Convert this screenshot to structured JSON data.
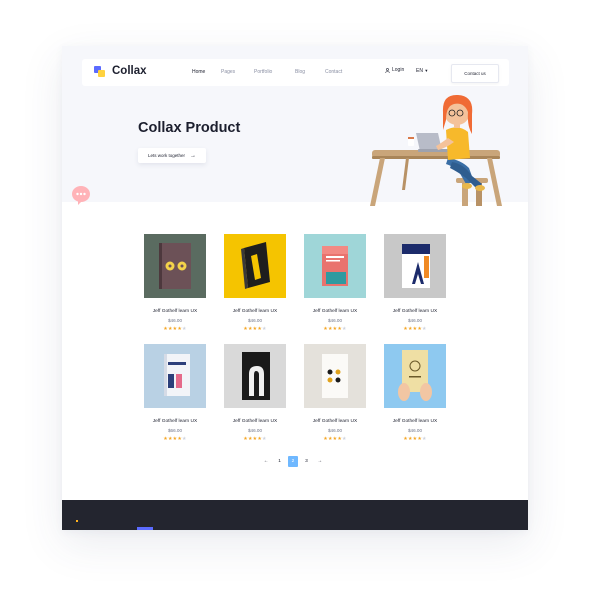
{
  "brand": {
    "name": "Collax"
  },
  "nav": {
    "links": [
      "Home",
      "Pages",
      "Portfolio",
      "Blog",
      "Contact"
    ],
    "active_index": 0,
    "login": "Login",
    "language": "EN",
    "contact_button": "Contact us"
  },
  "hero": {
    "title": "Collax Product",
    "cta": "Lets work together",
    "cta_icon": "arrow-right-icon"
  },
  "products": [
    {
      "title": "Jeff Gothelf learn UX",
      "price": "$46.00",
      "rating": 4,
      "max_rating": 5
    },
    {
      "title": "Jeff Gothelf learn UX",
      "price": "$46.00",
      "rating": 4,
      "max_rating": 5
    },
    {
      "title": "Jeff Gothelf learn UX",
      "price": "$46.00",
      "rating": 4,
      "max_rating": 5
    },
    {
      "title": "Jeff Gothelf learn UX",
      "price": "$46.00",
      "rating": 4,
      "max_rating": 5
    },
    {
      "title": "Jeff Gothelf learn UX",
      "price": "$66.00",
      "rating": 4,
      "max_rating": 5
    },
    {
      "title": "Jeff Gothelf learn UX",
      "price": "$46.00",
      "rating": 4,
      "max_rating": 5
    },
    {
      "title": "Jeff Gothelf learn UX",
      "price": "$46.00",
      "rating": 4,
      "max_rating": 5
    },
    {
      "title": "Jeff Gothelf learn UX",
      "price": "$46.00",
      "rating": 4,
      "max_rating": 5
    }
  ],
  "pagination": {
    "prev": "←",
    "pages": [
      "1",
      "2",
      "3"
    ],
    "current": "2",
    "next": "→"
  },
  "colors": {
    "accent": "#5b6bff",
    "brand_yellow": "#ffd23f",
    "star": "#f5a623",
    "page_active": "#6fb8ff",
    "footer": "#23252f"
  }
}
